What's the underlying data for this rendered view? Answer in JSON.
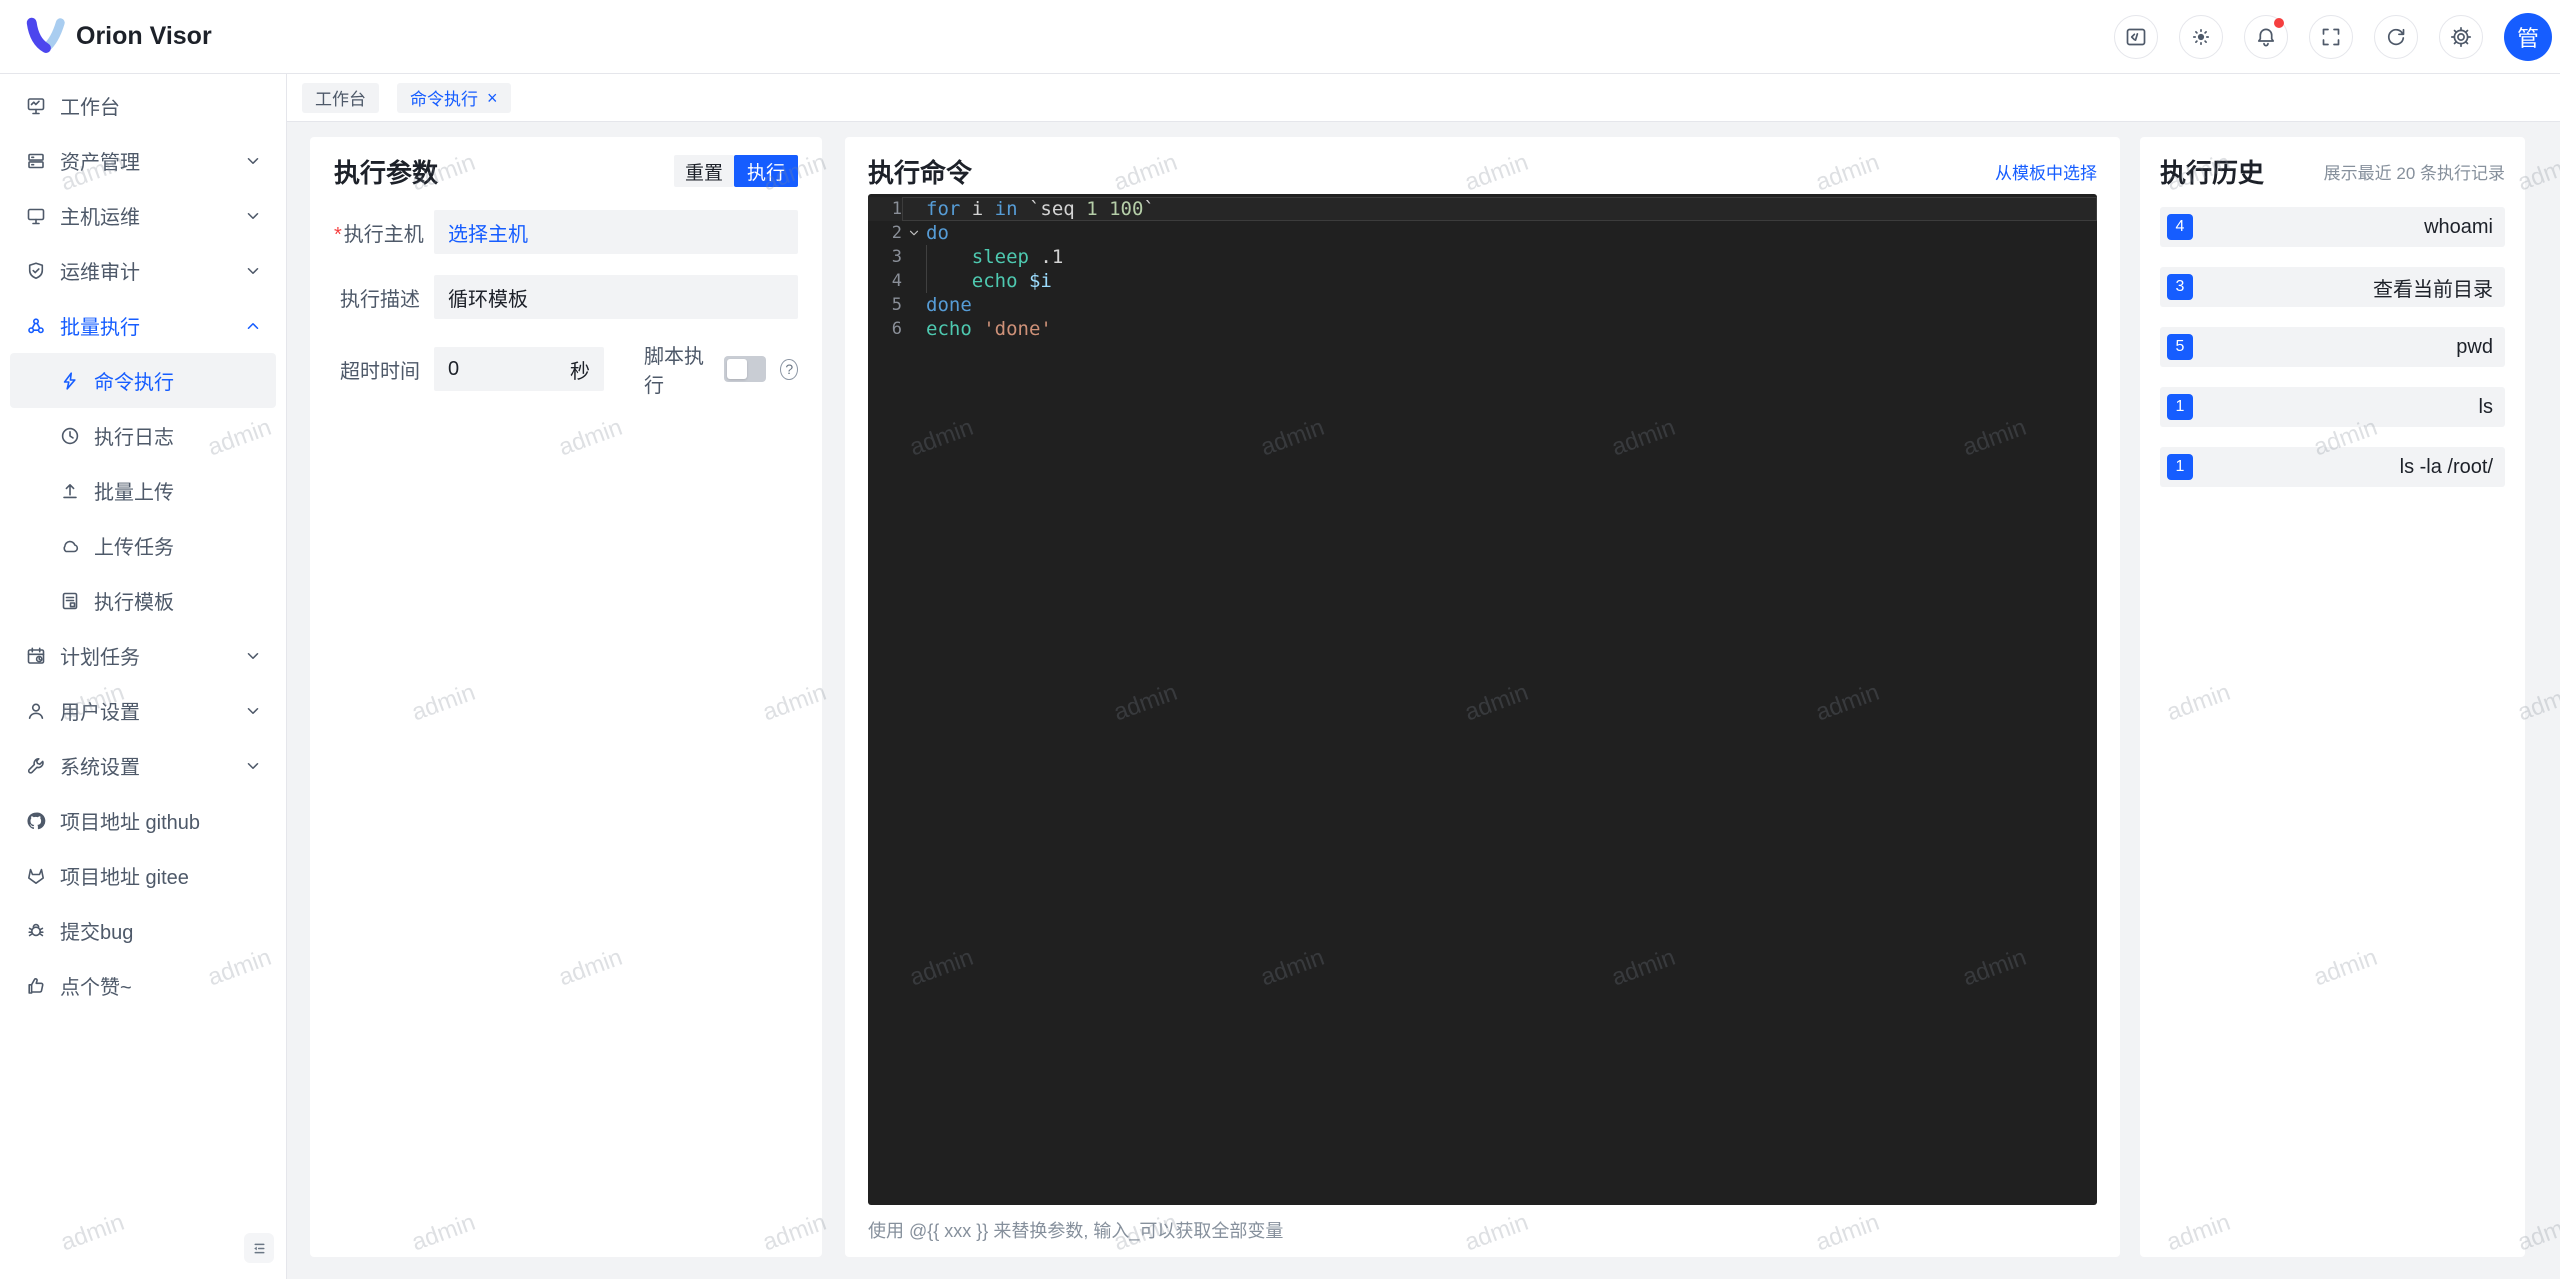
{
  "app": {
    "title": "Orion Visor",
    "avatar_text": "管"
  },
  "tabs": [
    {
      "id": "workbench",
      "label": "工作台",
      "active": false,
      "closable": false
    },
    {
      "id": "command-exec",
      "label": "命令执行",
      "active": true,
      "closable": true,
      "close_glyph": "×"
    }
  ],
  "sidebar": {
    "items": [
      {
        "id": "workbench",
        "label": "工作台",
        "level": "top",
        "icon": "workbench",
        "chevron": null
      },
      {
        "id": "assets",
        "label": "资产管理",
        "level": "top",
        "icon": "assets",
        "chevron": "down"
      },
      {
        "id": "host-ops",
        "label": "主机运维",
        "level": "top",
        "icon": "host",
        "chevron": "down"
      },
      {
        "id": "ops-audit",
        "label": "运维审计",
        "level": "top",
        "icon": "audit",
        "chevron": "down"
      },
      {
        "id": "batch-exec",
        "label": "批量执行",
        "level": "top",
        "icon": "batch",
        "chevron": "up",
        "accent": true
      },
      {
        "id": "command-exec",
        "label": "命令执行",
        "level": "sub",
        "icon": "bolt",
        "active": true
      },
      {
        "id": "exec-log",
        "label": "执行日志",
        "level": "sub",
        "icon": "clock"
      },
      {
        "id": "batch-upload",
        "label": "批量上传",
        "level": "sub",
        "icon": "upload"
      },
      {
        "id": "upload-task",
        "label": "上传任务",
        "level": "sub",
        "icon": "cloud"
      },
      {
        "id": "exec-template",
        "label": "执行模板",
        "level": "sub",
        "icon": "template"
      },
      {
        "id": "scheduled-task",
        "label": "计划任务",
        "level": "top",
        "icon": "calendar",
        "chevron": "down"
      },
      {
        "id": "user-settings",
        "label": "用户设置",
        "level": "top",
        "icon": "user",
        "chevron": "down"
      },
      {
        "id": "system-settings",
        "label": "系统设置",
        "level": "top",
        "icon": "wrench",
        "chevron": "down"
      },
      {
        "id": "github",
        "label": "项目地址 github",
        "level": "top",
        "icon": "github"
      },
      {
        "id": "gitee",
        "label": "项目地址 gitee",
        "level": "top",
        "icon": "gitee"
      },
      {
        "id": "report-bug",
        "label": "提交bug",
        "level": "top",
        "icon": "bug"
      },
      {
        "id": "like",
        "label": "点个赞~",
        "level": "top",
        "icon": "thumb"
      }
    ]
  },
  "params_panel": {
    "title": "执行参数",
    "reset_label": "重置",
    "execute_label": "执行",
    "host_field": {
      "required_mark": "*",
      "label": "执行主机",
      "value": "选择主机"
    },
    "desc_field": {
      "label": "执行描述",
      "value": "循环模板"
    },
    "timeout_field": {
      "label": "超时时间",
      "value": "0",
      "unit": "秒"
    },
    "script_field": {
      "label": "脚本执行",
      "enabled": false,
      "help_glyph": "?"
    }
  },
  "command_panel": {
    "title": "执行命令",
    "template_link": "从模板中选择",
    "hint": "使用 @{{ xxx }} 来替换参数, 输入_可以获取全部变量",
    "editor": {
      "lines": [
        {
          "num": "1",
          "current": true,
          "tokens": [
            {
              "c": "kw",
              "t": "for"
            },
            {
              "c": "pl",
              "t": " i "
            },
            {
              "c": "kw",
              "t": "in"
            },
            {
              "c": "pl",
              "t": " `seq "
            },
            {
              "c": "nu",
              "t": "1 100"
            },
            {
              "c": "pl",
              "t": "`"
            }
          ]
        },
        {
          "num": "2",
          "fold": true,
          "tokens": [
            {
              "c": "kw",
              "t": "do"
            }
          ]
        },
        {
          "num": "3",
          "guide": true,
          "tokens": [
            {
              "c": "pl",
              "t": "    "
            },
            {
              "c": "cmd",
              "t": "sleep"
            },
            {
              "c": "pl",
              "t": " .1"
            }
          ]
        },
        {
          "num": "4",
          "guide": true,
          "tokens": [
            {
              "c": "pl",
              "t": "    "
            },
            {
              "c": "cmd",
              "t": "echo"
            },
            {
              "c": "pl",
              "t": " "
            },
            {
              "c": "va",
              "t": "$i"
            }
          ]
        },
        {
          "num": "5",
          "tokens": [
            {
              "c": "kw",
              "t": "done"
            }
          ]
        },
        {
          "num": "6",
          "tokens": [
            {
              "c": "cmd",
              "t": "echo"
            },
            {
              "c": "pl",
              "t": " "
            },
            {
              "c": "st",
              "t": "'done'"
            }
          ]
        }
      ]
    }
  },
  "history_panel": {
    "title": "执行历史",
    "subtitle": "展示最近 20 条执行记录",
    "items": [
      {
        "count": "4",
        "command": "whoami"
      },
      {
        "count": "3",
        "command": "查看当前目录"
      },
      {
        "count": "5",
        "command": "pwd"
      },
      {
        "count": "1",
        "command": "ls"
      },
      {
        "count": "1",
        "command": "ls -la /root/"
      }
    ]
  },
  "watermark": {
    "text": "admin"
  },
  "colors": {
    "primary": "#165dff",
    "badge": "#165dff",
    "notification_dot": "#f53f3f",
    "editor_bg": "#202020"
  }
}
